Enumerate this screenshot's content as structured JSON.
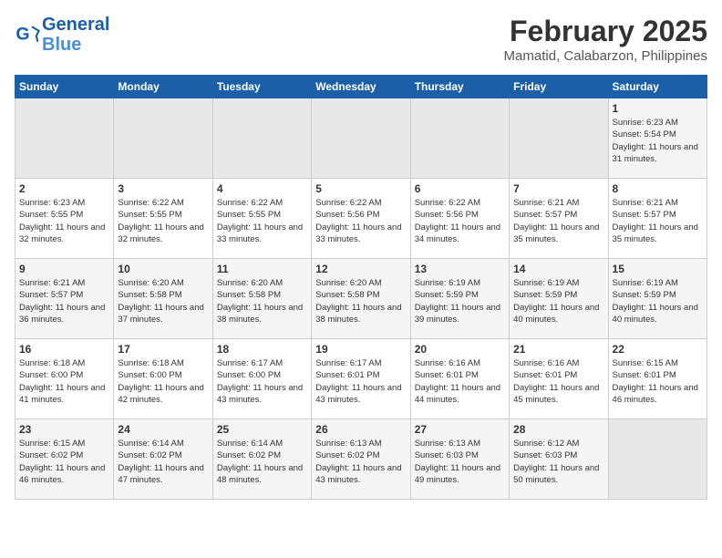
{
  "header": {
    "logo_line1": "General",
    "logo_line2": "Blue",
    "title": "February 2025",
    "subtitle": "Mamatid, Calabarzon, Philippines"
  },
  "days_of_week": [
    "Sunday",
    "Monday",
    "Tuesday",
    "Wednesday",
    "Thursday",
    "Friday",
    "Saturday"
  ],
  "weeks": [
    [
      {
        "day": "",
        "empty": true
      },
      {
        "day": "",
        "empty": true
      },
      {
        "day": "",
        "empty": true
      },
      {
        "day": "",
        "empty": true
      },
      {
        "day": "",
        "empty": true
      },
      {
        "day": "",
        "empty": true
      },
      {
        "day": "1",
        "sunrise": "6:23 AM",
        "sunset": "5:54 PM",
        "daylight": "11 hours and 31 minutes."
      }
    ],
    [
      {
        "day": "2",
        "sunrise": "6:23 AM",
        "sunset": "5:55 PM",
        "daylight": "11 hours and 32 minutes."
      },
      {
        "day": "3",
        "sunrise": "6:22 AM",
        "sunset": "5:55 PM",
        "daylight": "11 hours and 32 minutes."
      },
      {
        "day": "4",
        "sunrise": "6:22 AM",
        "sunset": "5:55 PM",
        "daylight": "11 hours and 33 minutes."
      },
      {
        "day": "5",
        "sunrise": "6:22 AM",
        "sunset": "5:56 PM",
        "daylight": "11 hours and 33 minutes."
      },
      {
        "day": "6",
        "sunrise": "6:22 AM",
        "sunset": "5:56 PM",
        "daylight": "11 hours and 34 minutes."
      },
      {
        "day": "7",
        "sunrise": "6:21 AM",
        "sunset": "5:57 PM",
        "daylight": "11 hours and 35 minutes."
      },
      {
        "day": "8",
        "sunrise": "6:21 AM",
        "sunset": "5:57 PM",
        "daylight": "11 hours and 35 minutes."
      }
    ],
    [
      {
        "day": "9",
        "sunrise": "6:21 AM",
        "sunset": "5:57 PM",
        "daylight": "11 hours and 36 minutes."
      },
      {
        "day": "10",
        "sunrise": "6:20 AM",
        "sunset": "5:58 PM",
        "daylight": "11 hours and 37 minutes."
      },
      {
        "day": "11",
        "sunrise": "6:20 AM",
        "sunset": "5:58 PM",
        "daylight": "11 hours and 38 minutes."
      },
      {
        "day": "12",
        "sunrise": "6:20 AM",
        "sunset": "5:58 PM",
        "daylight": "11 hours and 38 minutes."
      },
      {
        "day": "13",
        "sunrise": "6:19 AM",
        "sunset": "5:59 PM",
        "daylight": "11 hours and 39 minutes."
      },
      {
        "day": "14",
        "sunrise": "6:19 AM",
        "sunset": "5:59 PM",
        "daylight": "11 hours and 40 minutes."
      },
      {
        "day": "15",
        "sunrise": "6:19 AM",
        "sunset": "5:59 PM",
        "daylight": "11 hours and 40 minutes."
      }
    ],
    [
      {
        "day": "16",
        "sunrise": "6:18 AM",
        "sunset": "6:00 PM",
        "daylight": "11 hours and 41 minutes."
      },
      {
        "day": "17",
        "sunrise": "6:18 AM",
        "sunset": "6:00 PM",
        "daylight": "11 hours and 42 minutes."
      },
      {
        "day": "18",
        "sunrise": "6:17 AM",
        "sunset": "6:00 PM",
        "daylight": "11 hours and 43 minutes."
      },
      {
        "day": "19",
        "sunrise": "6:17 AM",
        "sunset": "6:01 PM",
        "daylight": "11 hours and 43 minutes."
      },
      {
        "day": "20",
        "sunrise": "6:16 AM",
        "sunset": "6:01 PM",
        "daylight": "11 hours and 44 minutes."
      },
      {
        "day": "21",
        "sunrise": "6:16 AM",
        "sunset": "6:01 PM",
        "daylight": "11 hours and 45 minutes."
      },
      {
        "day": "22",
        "sunrise": "6:15 AM",
        "sunset": "6:01 PM",
        "daylight": "11 hours and 46 minutes."
      }
    ],
    [
      {
        "day": "23",
        "sunrise": "6:15 AM",
        "sunset": "6:02 PM",
        "daylight": "11 hours and 46 minutes."
      },
      {
        "day": "24",
        "sunrise": "6:14 AM",
        "sunset": "6:02 PM",
        "daylight": "11 hours and 47 minutes."
      },
      {
        "day": "25",
        "sunrise": "6:14 AM",
        "sunset": "6:02 PM",
        "daylight": "11 hours and 48 minutes."
      },
      {
        "day": "26",
        "sunrise": "6:13 AM",
        "sunset": "6:02 PM",
        "daylight": "11 hours and 43 minutes."
      },
      {
        "day": "27",
        "sunrise": "6:13 AM",
        "sunset": "6:03 PM",
        "daylight": "11 hours and 49 minutes."
      },
      {
        "day": "28",
        "sunrise": "6:12 AM",
        "sunset": "6:03 PM",
        "daylight": "11 hours and 50 minutes."
      },
      {
        "day": "",
        "empty": true
      }
    ]
  ]
}
